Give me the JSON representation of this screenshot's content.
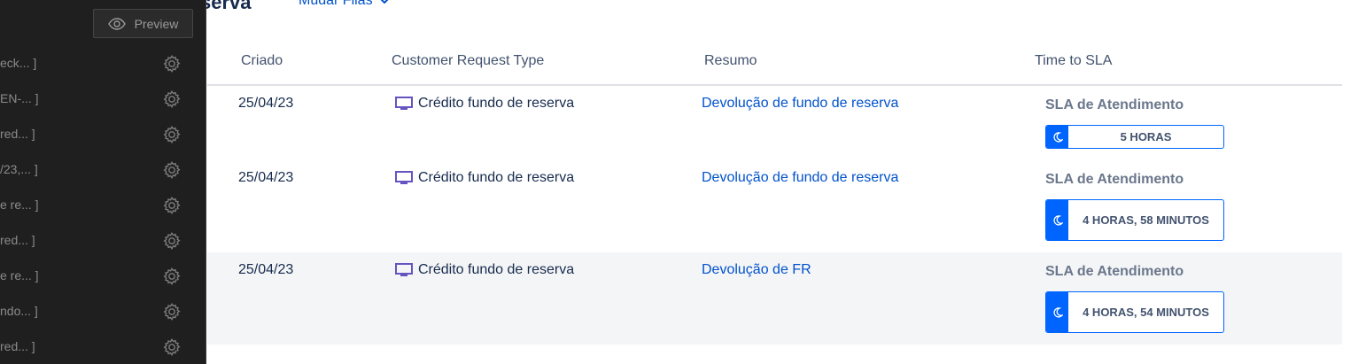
{
  "header": {
    "title": "serva",
    "queue_switch_label": "Mudar Filas"
  },
  "panel": {
    "preview_label": "Preview",
    "items": [
      {
        "label": "eck... ]"
      },
      {
        "label": "EN-... ]"
      },
      {
        "label": "red... ]"
      },
      {
        "label": "/23,... ]"
      },
      {
        "label": "e re... ]"
      },
      {
        "label": "red... ]"
      },
      {
        "label": "e re... ]"
      },
      {
        "label": "ndo... ]"
      },
      {
        "label": "red... ]"
      }
    ]
  },
  "table": {
    "columns": {
      "created": "Criado",
      "request_type": "Customer Request Type",
      "summary": "Resumo",
      "sla": "Time to SLA"
    },
    "rows": [
      {
        "created": "25/04/23",
        "request_type": "Crédito fundo de reserva",
        "summary": "Devolução de fundo de reserva",
        "sla_name": "SLA de Atendimento",
        "sla_time": "5 HORAS"
      },
      {
        "created": "25/04/23",
        "request_type": "Crédito fundo de reserva",
        "summary": "Devolução de fundo de reserva",
        "sla_name": "SLA de Atendimento",
        "sla_time": "4 HORAS, 58 MINUTOS"
      },
      {
        "created": "25/04/23",
        "request_type": "Crédito fundo de reserva",
        "summary": "Devolução de FR",
        "sla_name": "SLA de Atendimento",
        "sla_time": "4 HORAS, 54 MINUTOS"
      }
    ]
  },
  "colors": {
    "accent": "#0052cc",
    "sla_border": "#0065ff",
    "panel_bg": "#1f1f1f",
    "icon_purple": "#6554c0"
  },
  "icons": {
    "preview": "eye-icon",
    "settings": "gear-icon",
    "request_type": "monitor-icon",
    "sla_paused": "moon-icon",
    "dropdown": "chevron-down-icon"
  }
}
